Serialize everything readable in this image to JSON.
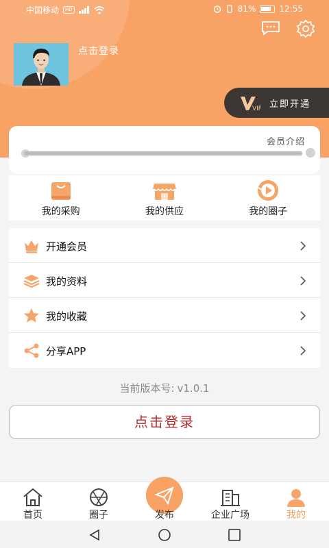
{
  "status_bar": {
    "carrier": "中国移动",
    "hd_badge": "HD",
    "network": "4G",
    "battery": "81%",
    "time": "12:55"
  },
  "profile": {
    "login_prompt": "点击登录"
  },
  "vip": {
    "badge": "VIP",
    "label": "立即开通"
  },
  "member_card": {
    "intro_link": "会员介绍",
    "progress": 1.0
  },
  "quick_actions": [
    {
      "label": "我的采购",
      "icon": "shopping-bag-icon"
    },
    {
      "label": "我的供应",
      "icon": "storefront-icon"
    },
    {
      "label": "我的圈子",
      "icon": "circle-play-icon"
    }
  ],
  "menu": [
    {
      "label": "开通会员",
      "icon": "crown-icon"
    },
    {
      "label": "我的资料",
      "icon": "layers-icon"
    },
    {
      "label": "我的收藏",
      "icon": "star-icon"
    },
    {
      "label": "分享APP",
      "icon": "share-icon"
    }
  ],
  "version": {
    "label": "当前版本号:",
    "value": "v1.0.1"
  },
  "login_button": "点击登录",
  "tabs": [
    {
      "label": "首页",
      "icon": "home-icon"
    },
    {
      "label": "圈子",
      "icon": "aperture-icon"
    },
    {
      "label": "发布",
      "icon": "paper-plane-icon"
    },
    {
      "label": "企业广场",
      "icon": "building-icon"
    },
    {
      "label": "我的",
      "icon": "user-icon",
      "active": true
    }
  ],
  "colors": {
    "accent": "#f9a266",
    "vip_bg": "#3d3733",
    "login_red": "#b52a28",
    "active_tab": "#f0a060"
  }
}
